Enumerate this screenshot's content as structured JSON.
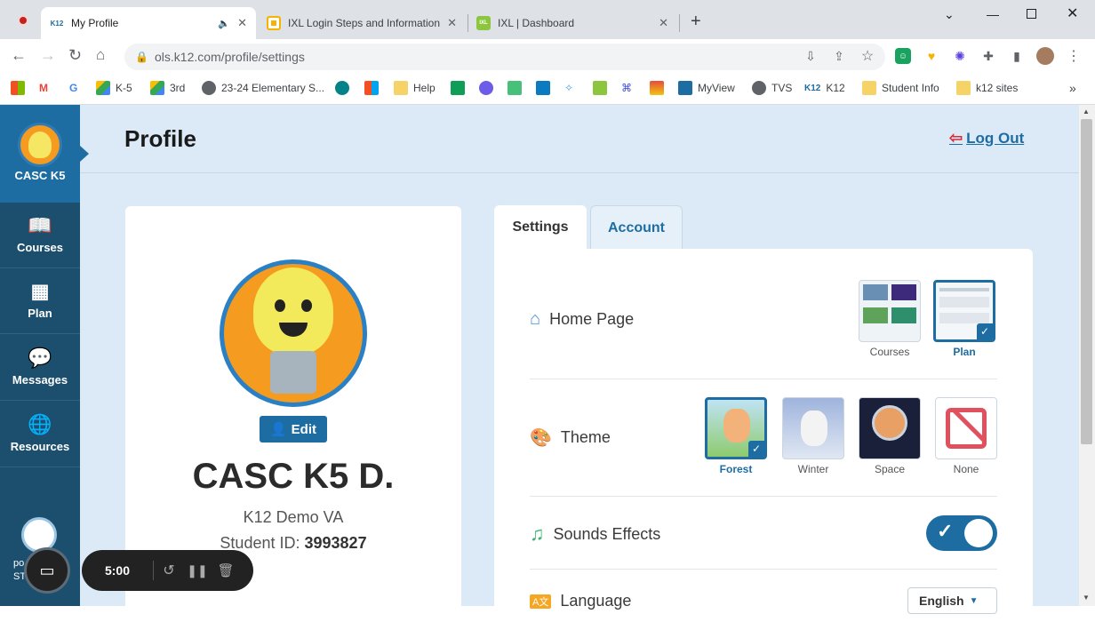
{
  "browser": {
    "tabs": [
      {
        "title": "My Profile",
        "icon": "k12-icon",
        "active": true
      },
      {
        "title": "IXL Login Steps and Information",
        "icon": "slides-icon"
      },
      {
        "title": "IXL | Dashboard",
        "icon": "ixl-icon"
      }
    ],
    "url": "ols.k12.com/profile/settings",
    "bookmarks": [
      {
        "label": "K-5"
      },
      {
        "label": "3rd"
      },
      {
        "label": "23-24 Elementary S..."
      },
      {
        "label": "Help"
      },
      {
        "label": "MyView"
      },
      {
        "label": "TVS"
      },
      {
        "label": "K12"
      },
      {
        "label": "Student Info"
      },
      {
        "label": "k12 sites"
      }
    ],
    "bookmark_letter": "G",
    "bookmark_overflow": "»"
  },
  "sidebar": {
    "brand": "CASC K5",
    "items": [
      {
        "label": "Courses",
        "icon": "book-icon"
      },
      {
        "label": "Plan",
        "icon": "calendar-icon"
      },
      {
        "label": "Messages",
        "icon": "message-icon"
      },
      {
        "label": "Resources",
        "icon": "globe-icon"
      }
    ],
    "bottom_text_1": "po",
    "bottom_text_2": "ST"
  },
  "page": {
    "title": "Profile",
    "logout": "Log Out"
  },
  "profile": {
    "edit_label": "Edit",
    "name": "CASC K5 D.",
    "school": "K12 Demo VA",
    "student_id_label": "Student ID:",
    "student_id": "3993827"
  },
  "tabs": {
    "settings": "Settings",
    "account": "Account"
  },
  "settings": {
    "home_page": {
      "label": "Home Page",
      "options": [
        {
          "label": "Courses",
          "selected": false
        },
        {
          "label": "Plan",
          "selected": true
        }
      ]
    },
    "theme": {
      "label": "Theme",
      "options": [
        {
          "label": "Forest",
          "selected": true
        },
        {
          "label": "Winter",
          "selected": false
        },
        {
          "label": "Space",
          "selected": false
        },
        {
          "label": "None",
          "selected": false
        }
      ]
    },
    "sounds": {
      "label": "Sounds Effects",
      "enabled": true
    },
    "language": {
      "label": "Language",
      "value": "English"
    }
  },
  "recorder": {
    "time": "5:00"
  },
  "colors": {
    "primary": "#1d6da3",
    "sidebar": "#1c4f6e",
    "background": "#dbeaf6"
  }
}
